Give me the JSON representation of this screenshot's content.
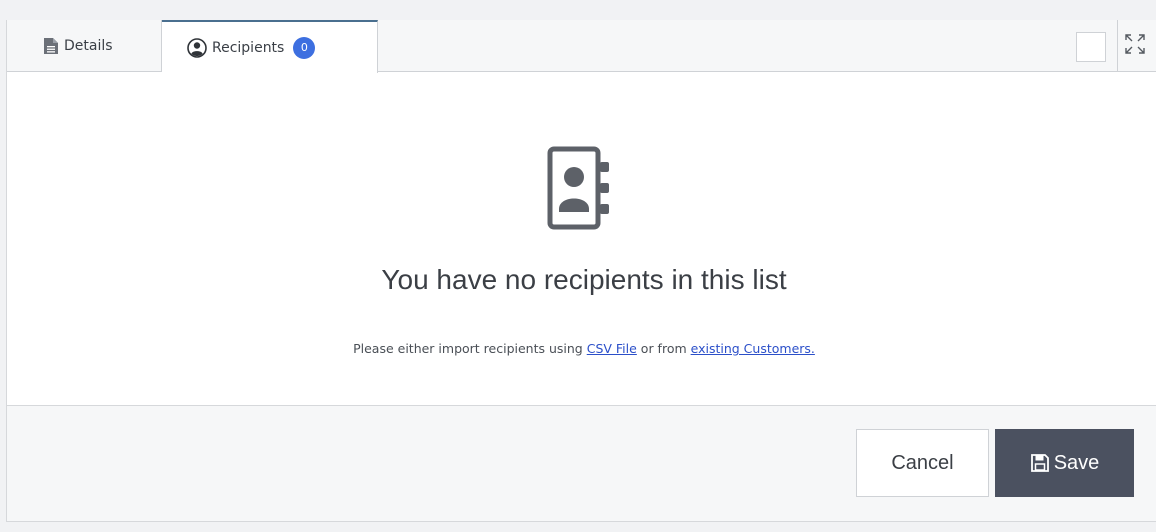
{
  "tabs": {
    "details": {
      "label": "Details",
      "icon": "document-icon"
    },
    "recipients": {
      "label": "Recipients",
      "icon": "user-circle-icon",
      "count": "0"
    }
  },
  "empty_state": {
    "icon": "address-book-icon",
    "title": "You have no recipients in this list",
    "text_before": "Please either import recipients using ",
    "csv_link": "CSV File",
    "text_middle": " or from ",
    "customers_link": "existing Customers."
  },
  "footer": {
    "cancel_label": "Cancel",
    "save_label": "Save",
    "save_icon": "floppy-disk-icon"
  },
  "colors": {
    "accent": "#3d6fe0",
    "link": "#2b4fc9",
    "save_button": "#4b5160",
    "active_tab_border": "#4a6f8f"
  }
}
